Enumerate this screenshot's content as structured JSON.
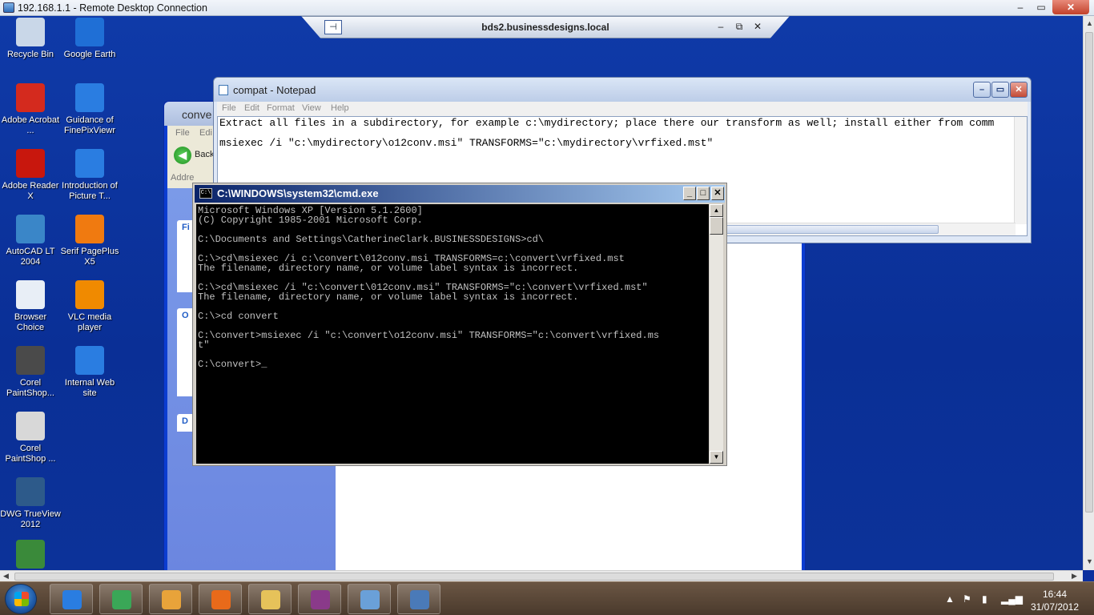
{
  "rdp": {
    "title": "192.168.1.1 - Remote Desktop Connection",
    "min": "–",
    "max": "▭",
    "close": "✕",
    "connection_bar": {
      "host": "bds2.businessdesigns.local",
      "pin": "⊣",
      "min": "–",
      "restore": "⧉",
      "close": "✕"
    }
  },
  "desktop_icons": [
    {
      "label": "Recycle Bin",
      "icon": "recycle-bin-icon",
      "color": "#c9d7e8"
    },
    {
      "label": "Google Earth",
      "icon": "google-earth-icon",
      "color": "#1f6fd6"
    },
    {
      "label": "Adobe Acrobat ...",
      "icon": "adobe-acrobat-icon",
      "color": "#d42a1e"
    },
    {
      "label": "Guidance of FinePixViewr",
      "icon": "internet-explorer-icon",
      "color": "#2a7de1"
    },
    {
      "label": "Adobe Reader X",
      "icon": "adobe-reader-icon",
      "color": "#c8170d"
    },
    {
      "label": "Introduction of Picture T...",
      "icon": "internet-explorer-icon",
      "color": "#2a7de1"
    },
    {
      "label": "AutoCAD LT 2004",
      "icon": "autocad-icon",
      "color": "#3a86c8"
    },
    {
      "label": "Serif PagePlus X5",
      "icon": "pageplus-icon",
      "color": "#f07a10"
    },
    {
      "label": "Browser Choice",
      "icon": "browser-choice-icon",
      "color": "#e8eef6"
    },
    {
      "label": "VLC media player",
      "icon": "vlc-icon",
      "color": "#f08a00"
    },
    {
      "label": "Corel PaintShop...",
      "icon": "corel-paintshop-icon",
      "color": "#4a4a4a"
    },
    {
      "label": "Internal Web site",
      "icon": "internet-explorer-icon",
      "color": "#2a7de1"
    },
    {
      "label": "Corel PaintShop ...",
      "icon": "corel-paintshop-icon",
      "color": "#d8d8d8"
    },
    {
      "label": "DWG TrueView 2012",
      "icon": "dwg-trueview-icon",
      "color": "#2d5a8a"
    },
    {
      "label": "",
      "icon": "partial-icon",
      "color": "#3a8a3a"
    }
  ],
  "explorer": {
    "title": "conve",
    "menu": [
      "File",
      "Edi"
    ],
    "back_label": "Back",
    "address_label": "Addre",
    "left_boxes": [
      "Fi",
      "O",
      "D"
    ]
  },
  "notepad": {
    "title": "compat - Notepad",
    "menu": [
      "File",
      "Edit",
      "Format",
      "View",
      "Help"
    ],
    "lines": [
      "Extract all files in a subdirectory, for example c:\\mydirectory; place there our transform as well; install either from comm",
      "msiexec /i \"c:\\mydirectory\\o12conv.msi\" TRANSFORMS=\"c:\\mydirectory\\vrfixed.mst\""
    ],
    "min": "–",
    "max": "▭",
    "close": "✕"
  },
  "cmd": {
    "title": "C:\\WINDOWS\\system32\\cmd.exe",
    "icon_text": "C:\\",
    "min": "_",
    "max": "□",
    "close": "✕",
    "lines": [
      "Microsoft Windows XP [Version 5.1.2600]",
      "(C) Copyright 1985-2001 Microsoft Corp.",
      "",
      "C:\\Documents and Settings\\CatherineClark.BUSINESSDESIGNS>cd\\",
      "",
      "C:\\>cd\\msiexec /i c:\\convert\\012conv.msi TRANSFORMS=c:\\convert\\vrfixed.mst",
      "The filename, directory name, or volume label syntax is incorrect.",
      "",
      "C:\\>cd\\msiexec /i \"c:\\convert\\012conv.msi\" TRANSFORMS=\"c:\\convert\\vrfixed.mst\"",
      "The filename, directory name, or volume label syntax is incorrect.",
      "",
      "C:\\>cd convert",
      "",
      "C:\\convert>msiexec /i \"c:\\convert\\o12conv.msi\" TRANSFORMS=\"c:\\convert\\vrfixed.ms",
      "t\"",
      "",
      "C:\\convert>_"
    ],
    "scroll_up": "▲",
    "scroll_down": "▼"
  },
  "taskbar": {
    "buttons": [
      {
        "name": "internet-explorer",
        "color": "#2a7de1"
      },
      {
        "name": "chrome",
        "color": "#3aa757"
      },
      {
        "name": "outlook",
        "color": "#e8a33a"
      },
      {
        "name": "firefox",
        "color": "#e86a1a"
      },
      {
        "name": "windows-explorer",
        "color": "#e6c25a"
      },
      {
        "name": "winrar",
        "color": "#8a3a8a"
      },
      {
        "name": "control-panel",
        "color": "#6aa0d8"
      },
      {
        "name": "remote-desktop",
        "color": "#4a7ab8"
      }
    ],
    "time": "16:44",
    "date": "31/07/2012"
  }
}
